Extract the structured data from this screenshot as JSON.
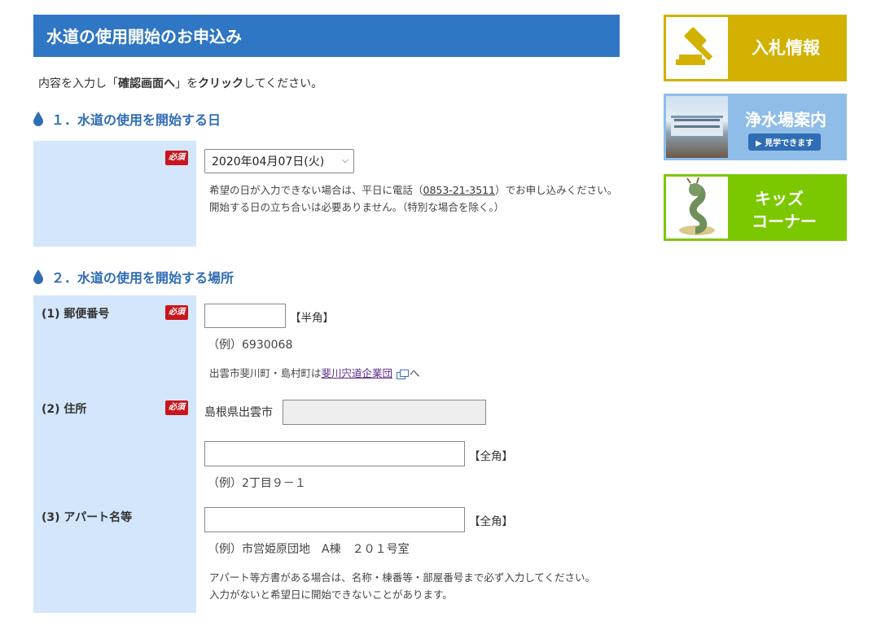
{
  "header": {
    "title": "水道の使用開始のお申込み"
  },
  "intro": {
    "part1": "内容を入力し「",
    "bold1": "確認画面へ",
    "part2": "」を",
    "bold2": "クリック",
    "part3": "してください。"
  },
  "section1": {
    "heading": "１．水道の使用を開始する日",
    "required_label": "必須",
    "date_select": {
      "value": "2020年04月07日(火)"
    },
    "note_line1_pre": "希望の日が入力できない場合は、平日に電話（",
    "phone": "0853-21-3511",
    "note_line1_post": "）でお申し込みください。",
    "note_line2": "開始する日の立ち合いは必要ありません。（特別な場合を除く。）"
  },
  "section2": {
    "heading": "２．水道の使用を開始する場所",
    "postal": {
      "label": "(1) 郵便番号",
      "required_label": "必須",
      "suffix": "【半角】",
      "example": "（例）6930068",
      "note_pre": "出雲市斐川町・島村町は",
      "note_link": "斐川宍道企業団",
      "note_post": "へ"
    },
    "address": {
      "label": "(2) 住所",
      "required_label": "必須",
      "prefix": "島根県出雲市",
      "suffix": "【全角】",
      "example": "（例）2丁目９－１"
    },
    "apartment": {
      "label": "(3) アパート名等",
      "suffix": "【全角】",
      "example": "（例）市営姫原団地　A棟　２０１号室",
      "note_line1": "アパート等方書がある場合は、名称・棟番等・部屋番号まで必ず入力してください。",
      "note_line2": "入力がないと希望日に開始できないことがあります。"
    }
  },
  "sidebar": {
    "bid": {
      "label": "入札情報",
      "color": "#d2b100",
      "icon": "gavel-icon"
    },
    "water_plant": {
      "label": "浄水場案内",
      "sub": "▶ 見学できます",
      "color": "#8fbde8"
    },
    "kids": {
      "label_line1": "キッズ",
      "label_line2": "コーナー",
      "color": "#7cc800",
      "icon": "dragon-mascot-icon"
    }
  },
  "colors": {
    "title_bg": "#2f76c4",
    "label_bg": "#d3e6fb",
    "required_bg": "#c8161d",
    "heading": "#2f6db5"
  }
}
